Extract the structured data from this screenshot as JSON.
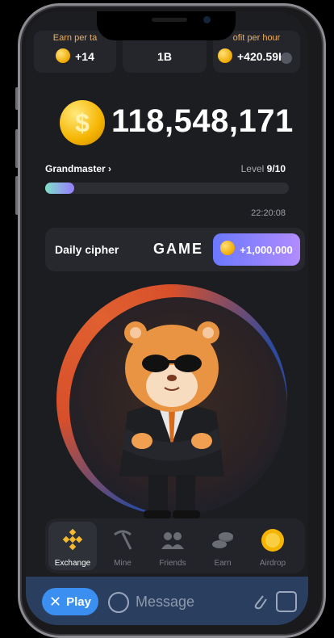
{
  "stats": [
    {
      "label": "Earn per ta",
      "value": "+14"
    },
    {
      "label": "",
      "value": "1B"
    },
    {
      "label": "ofit per hour",
      "value": "+420.59K"
    }
  ],
  "balance": {
    "amount": "118,548,171"
  },
  "rank": {
    "name": "Grandmaster",
    "chevron": "›",
    "level_label": "Level",
    "level_value": "9/10"
  },
  "progress": {
    "fraction": 0.12
  },
  "clock": "22:20:08",
  "cipher": {
    "title": "Daily cipher",
    "word": "GAME",
    "reward": "+1,000,000"
  },
  "nav": [
    {
      "label": "Exchange",
      "icon": "binance-icon",
      "active": true
    },
    {
      "label": "Mine",
      "icon": "pickaxe-icon",
      "active": false
    },
    {
      "label": "Friends",
      "icon": "friends-icon",
      "active": false
    },
    {
      "label": "Earn",
      "icon": "coins-icon",
      "active": false
    },
    {
      "label": "Airdrop",
      "icon": "airdrop-coin-icon",
      "active": false
    }
  ],
  "messagebar": {
    "play_label": "Play",
    "play_icon": "close-icon",
    "placeholder": "Message"
  },
  "colors": {
    "accent": "#3b8ff0",
    "coin": "#f5b400",
    "reward_start": "#6a78ff",
    "reward_end": "#b28cff",
    "ring": "#d84f2a"
  }
}
